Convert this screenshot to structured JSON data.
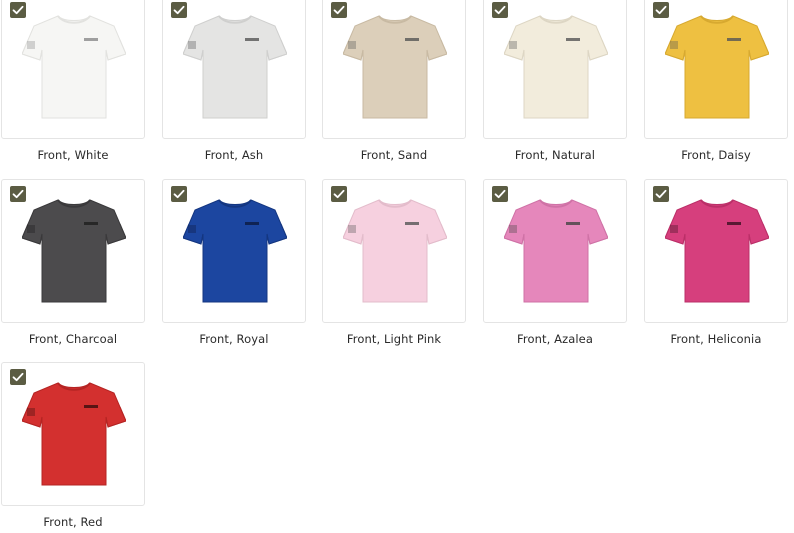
{
  "products": [
    {
      "label": "Front, White",
      "color": "#f6f6f4",
      "shade": "#e2e2df",
      "print": "#8a8a8a",
      "selected": true
    },
    {
      "label": "Front, Ash",
      "color": "#e4e4e3",
      "shade": "#cfcfce",
      "print": "#555555",
      "selected": true
    },
    {
      "label": "Front, Sand",
      "color": "#dccfba",
      "shade": "#c8baa3",
      "print": "#555555",
      "selected": true
    },
    {
      "label": "Front, Natural",
      "color": "#f2ecdc",
      "shade": "#ddd6c4",
      "print": "#555555",
      "selected": true
    },
    {
      "label": "Front, Daisy",
      "color": "#eec041",
      "shade": "#d7a930",
      "print": "#555555",
      "selected": true
    },
    {
      "label": "Front, Charcoal",
      "color": "#4c4b4d",
      "shade": "#3a393b",
      "print": "#1e1e1e",
      "selected": true
    },
    {
      "label": "Front, Royal",
      "color": "#1c46a0",
      "shade": "#143680",
      "print": "#0d1a40",
      "selected": true
    },
    {
      "label": "Front, Light Pink",
      "color": "#f6d0df",
      "shade": "#e3bccb",
      "print": "#555555",
      "selected": true
    },
    {
      "label": "Front, Azalea",
      "color": "#e587bb",
      "shade": "#cf72a6",
      "print": "#444444",
      "selected": true
    },
    {
      "label": "Front, Heliconia",
      "color": "#d63f7d",
      "shade": "#bb2f68",
      "print": "#3a1020",
      "selected": true
    },
    {
      "label": "Front, Red",
      "color": "#d3302f",
      "shade": "#b52423",
      "print": "#3a0e0e",
      "selected": true
    }
  ]
}
